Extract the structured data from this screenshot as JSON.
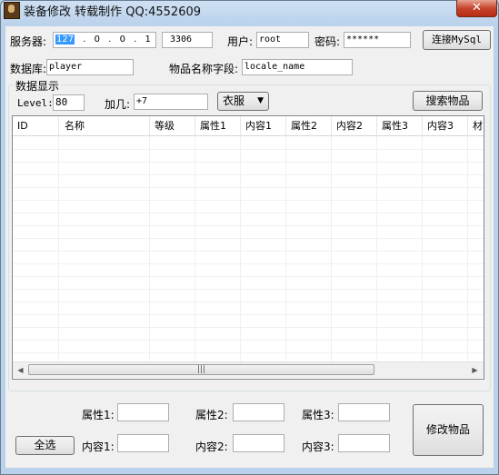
{
  "window": {
    "title": "装备修改 转载制作 QQ:4552609",
    "close_label": "✕"
  },
  "connection": {
    "server_label": "服务器:",
    "ip_parts": [
      "127",
      "0",
      "0",
      "1"
    ],
    "ip_dots": [
      ".",
      ".",
      "."
    ],
    "port": "3306",
    "user_label": "用户:",
    "user": "root",
    "password_label": "密码:",
    "password": "******",
    "connect_button": "连接MySql"
  },
  "db": {
    "db_label": "数据库:",
    "db_value": "player",
    "field_label": "物品名称字段:",
    "field_value": "locale_name"
  },
  "display": {
    "group_label": "数据显示",
    "level_label": "Level:",
    "level_value": "80",
    "plus_label": "加几:",
    "plus_value": "+7",
    "category_value": "衣服",
    "search_button": "搜索物品"
  },
  "table": {
    "columns": [
      "ID",
      "名称",
      "等级",
      "属性1",
      "内容1",
      "属性2",
      "内容2",
      "属性3",
      "内容3",
      "材"
    ]
  },
  "edit": {
    "attr1_label": "属性1:",
    "attr2_label": "属性2:",
    "attr3_label": "属性3:",
    "content1_label": "内容1:",
    "content2_label": "内容2:",
    "content3_label": "内容3:",
    "attr1_value": "",
    "attr2_value": "",
    "attr3_value": "",
    "content1_value": "",
    "content2_value": "",
    "content3_value": "",
    "select_all_button": "全选",
    "modify_button": "修改物品"
  }
}
